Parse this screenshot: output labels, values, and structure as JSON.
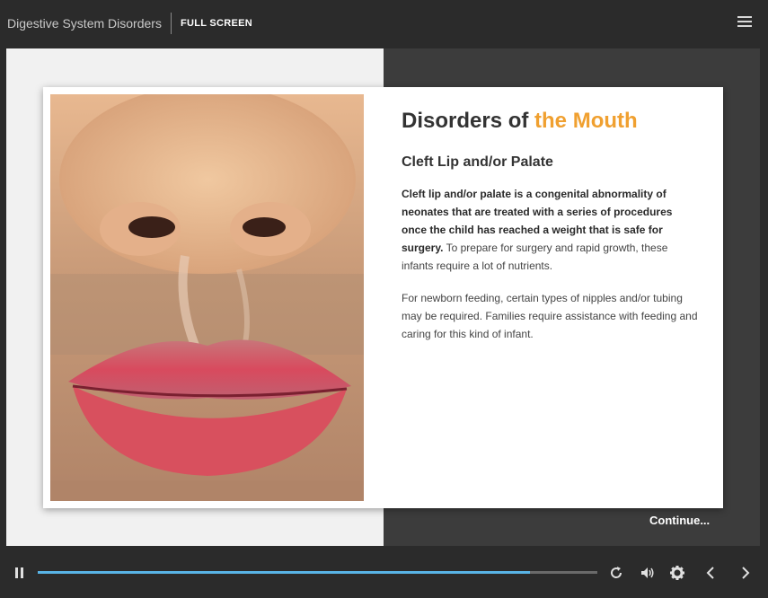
{
  "header": {
    "course_title": "Digestive System Disorders",
    "fullscreen_label": "FULL SCREEN",
    "menu_icon": "hamburger-icon"
  },
  "slide": {
    "heading_prefix": "Disorders of ",
    "heading_accent": "the Mouth",
    "subheading": "Cleft Lip and/or Palate",
    "para1_bold": "Cleft lip and/or palate is a congenital abnormality of neonates that are treated with a series of procedures once the child has reached a weight that is safe for surgery.",
    "para1_rest": " To prepare for surgery and rapid growth, these infants require a lot of nutrients.",
    "para2": "For newborn feeding, certain types of nipples and/or tubing may be required. Families require assistance with feeding and caring for this kind of infant.",
    "continue_label": "Continue..."
  },
  "player": {
    "progress": 0.88,
    "icons": [
      "pause-icon",
      "replay-icon",
      "volume-icon",
      "settings-icon",
      "previous-icon",
      "next-icon"
    ]
  },
  "colors": {
    "accent": "#f0a030",
    "progress": "#59b4e6",
    "background": "#2b2b2b"
  }
}
